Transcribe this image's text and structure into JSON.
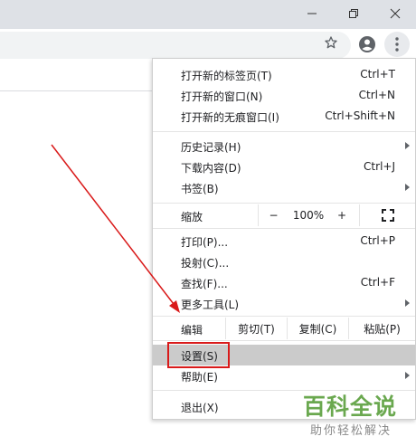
{
  "window": {
    "icons": [
      "minimize-icon",
      "restore-icon",
      "close-icon"
    ]
  },
  "toolbar": {
    "icons": [
      "star-icon",
      "profile-icon",
      "more-icon"
    ]
  },
  "menu": {
    "group1": [
      {
        "label": "打开新的标签页(T)",
        "shortcut": "Ctrl+T"
      },
      {
        "label": "打开新的窗口(N)",
        "shortcut": "Ctrl+N"
      },
      {
        "label": "打开新的无痕窗口(I)",
        "shortcut": "Ctrl+Shift+N"
      }
    ],
    "group2": [
      {
        "label": "历史记录(H)",
        "shortcut": ""
      },
      {
        "label": "下载内容(D)",
        "shortcut": "Ctrl+J"
      },
      {
        "label": "书签(B)",
        "shortcut": ""
      }
    ],
    "zoom": {
      "label": "缩放",
      "minus": "−",
      "value": "100%",
      "plus": "+"
    },
    "group3": [
      {
        "label": "打印(P)...",
        "shortcut": "Ctrl+P"
      },
      {
        "label": "投射(C)...",
        "shortcut": ""
      },
      {
        "label": "查找(F)...",
        "shortcut": "Ctrl+F"
      },
      {
        "label": "更多工具(L)",
        "shortcut": ""
      }
    ],
    "edit": {
      "label": "编辑",
      "cut": "剪切(T)",
      "copy": "复制(C)",
      "paste": "粘贴(P)"
    },
    "group4": [
      {
        "label": "设置(S)",
        "shortcut": ""
      },
      {
        "label": "帮助(E)",
        "shortcut": ""
      }
    ],
    "exit": {
      "label": "退出(X)"
    }
  },
  "watermark": {
    "title": "百科全说",
    "subtitle": "助你轻松解决"
  },
  "colors": {
    "annotation": "#d91a1a",
    "highlight": "#cbcbcb",
    "watermark": "#6aa84f"
  }
}
